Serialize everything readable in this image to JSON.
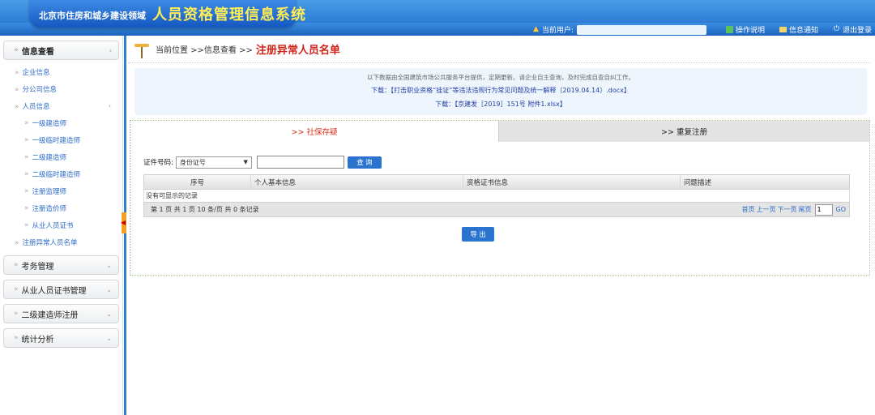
{
  "header": {
    "logo_small": "北京市住房和城乡建设领域",
    "logo_big": "人员资格管理信息系统",
    "current_user_label": "当前用户:",
    "help_label": "操作说明",
    "notice_label": "信息通知",
    "logout_label": "退出登录"
  },
  "sidebar": {
    "sections": [
      {
        "label": "信息查看"
      },
      {
        "label": "考务管理"
      },
      {
        "label": "从业人员证书管理"
      },
      {
        "label": "二级建造师注册"
      },
      {
        "label": "统计分析"
      }
    ],
    "info_items": {
      "enterprise": "企业信息",
      "branch": "分公司信息",
      "personnel": "人员信息",
      "abnormal": "注册异常人员名单"
    },
    "personnel_subitems": [
      "一级建造师",
      "一级临时建造师",
      "二级建造师",
      "二级临时建造师",
      "注册监理师",
      "注册造价师",
      "从业人员证书"
    ]
  },
  "breadcrumb": {
    "prefix": "当前位置 >>信息查看 >>",
    "current": "注册异常人员名单"
  },
  "notice": {
    "line1": "以下数据由全国建筑市场公共服务平台提供，定期更新。请企业自主查询，及时完成自查自纠工作。",
    "line2": "下载：【打击职业资格“挂证”等违法违规行为常见问题及统一解释（2019.04.14）.docx】",
    "line3": "下载：【京建发［2019］151号 附件1.xlsx】"
  },
  "tabs": {
    "social": ">> 社保存疑",
    "duplicate": ">> 重复注册"
  },
  "search": {
    "label": "证件号码:",
    "select_value": "身份证号",
    "input_value": "",
    "query_label": "查 询"
  },
  "table": {
    "headers": [
      "序号",
      "个人基本信息",
      "资格证书信息",
      "问题描述"
    ],
    "empty_message": "没有可显示的记录"
  },
  "pager": {
    "info": "第 1 页  共 1 页  10 条/页  共 0 条记录",
    "first": "首页",
    "prev": "上一页",
    "next": "下一页",
    "last": "尾页",
    "page_value": "1",
    "go": "GO"
  },
  "export_label": "导 出",
  "colors": {
    "header_blue": "#2f7fd6",
    "title_yellow": "#ffee55",
    "active_tab_red": "#e0311f",
    "link_blue": "#2c6ac8",
    "button_blue": "#2a74cf"
  },
  "icons": {
    "user": "warning-user-icon",
    "help": "book-icon",
    "notice": "envelope-icon",
    "logout": "power-icon"
  }
}
